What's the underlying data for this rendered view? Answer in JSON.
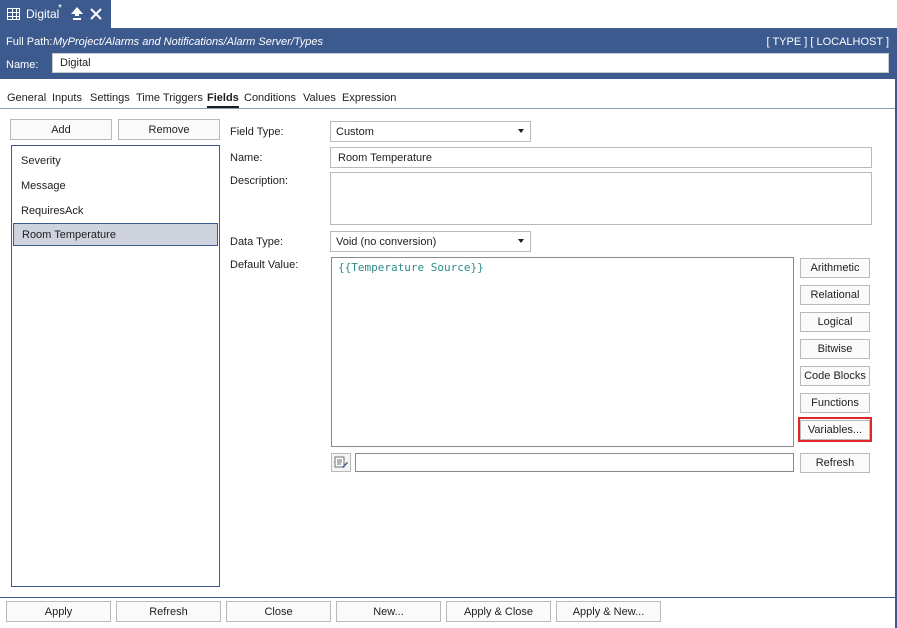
{
  "tab": {
    "title": "Digital",
    "modified_mark": "*"
  },
  "header": {
    "full_path_label": "Full Path:",
    "full_path": "MyProject/Alarms and Notifications/Alarm Server/Types",
    "type_tag": "[ TYPE ] [ LOCALHOST ]",
    "name_label": "Name:",
    "name_value": "Digital"
  },
  "tabs": [
    {
      "label": "General"
    },
    {
      "label": "Inputs"
    },
    {
      "label": "Settings"
    },
    {
      "label": "Time Triggers"
    },
    {
      "label": "Fields",
      "active": true
    },
    {
      "label": "Conditions"
    },
    {
      "label": "Values"
    },
    {
      "label": "Expression"
    }
  ],
  "left_panel": {
    "add_label": "Add",
    "remove_label": "Remove",
    "items": [
      "Severity",
      "Message",
      "RequiresAck",
      "Room Temperature"
    ],
    "selected_index": 3
  },
  "form": {
    "field_type_label": "Field Type:",
    "field_type_value": "Custom",
    "name_label": "Name:",
    "name_value": "Room Temperature",
    "description_label": "Description:",
    "description_value": "",
    "data_type_label": "Data Type:",
    "data_type_value": "Void (no conversion)",
    "default_value_label": "Default Value:",
    "default_value_code": "{{Temperature Source}}",
    "expression_input_value": ""
  },
  "side_buttons": {
    "arithmetic": "Arithmetic",
    "relational": "Relational",
    "logical": "Logical",
    "bitwise": "Bitwise",
    "code_blocks": "Code Blocks",
    "functions": "Functions",
    "variables": "Variables...",
    "refresh": "Refresh"
  },
  "footer": {
    "apply": "Apply",
    "refresh": "Refresh",
    "close": "Close",
    "new": "New...",
    "apply_close": "Apply & Close",
    "apply_new": "Apply & New..."
  },
  "colors": {
    "header_bg": "#3d5a8e",
    "highlight": "#e0262b",
    "code_text": "#2e8b8b"
  }
}
